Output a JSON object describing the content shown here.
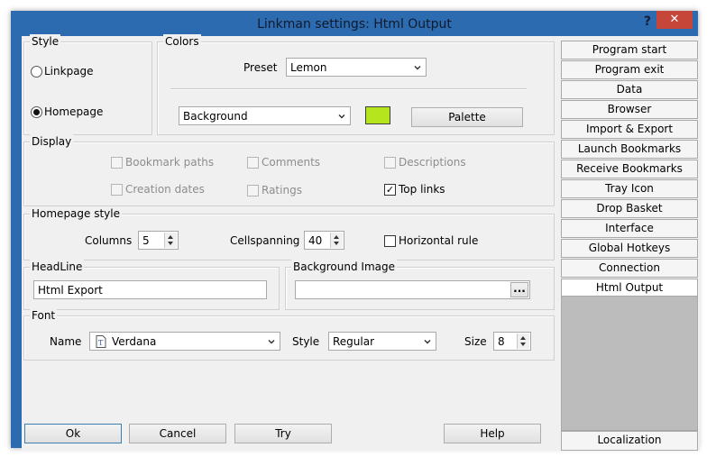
{
  "window": {
    "title": "Linkman settings: Html Output",
    "help_glyph": "?",
    "close_glyph": "✕"
  },
  "style_group": {
    "label": "Style",
    "linkpage": "Linkpage",
    "homepage": "Homepage",
    "selected": "Homepage"
  },
  "colors_group": {
    "label": "Colors",
    "preset_label": "Preset",
    "preset_value": "Lemon",
    "target_value": "Background",
    "swatch_color": "#b5e61d",
    "palette_button": "Palette"
  },
  "display_group": {
    "label": "Display",
    "items": [
      {
        "label": "Bookmark paths",
        "checked": false,
        "enabled": false
      },
      {
        "label": "Comments",
        "checked": false,
        "enabled": false
      },
      {
        "label": "Descriptions",
        "checked": false,
        "enabled": false
      },
      {
        "label": "Creation dates",
        "checked": false,
        "enabled": false
      },
      {
        "label": "Ratings",
        "checked": false,
        "enabled": false
      },
      {
        "label": "Top links",
        "checked": true,
        "enabled": true
      }
    ]
  },
  "homepage_style": {
    "label": "Homepage style",
    "columns_label": "Columns",
    "columns_value": "5",
    "cellspanning_label": "Cellspanning",
    "cellspanning_value": "40",
    "horizontal_rule_label": "Horizontal rule",
    "horizontal_rule_checked": false
  },
  "headline": {
    "label": "HeadLine",
    "value": "Html Export"
  },
  "background_image": {
    "label": "Background Image",
    "value": "",
    "browse_button": "..."
  },
  "font": {
    "label": "Font",
    "name_label": "Name",
    "name_value": "Verdana",
    "style_label": "Style",
    "style_value": "Regular",
    "size_label": "Size",
    "size_value": "8"
  },
  "buttons": {
    "ok": "Ok",
    "cancel": "Cancel",
    "try": "Try",
    "help": "Help"
  },
  "sidebar": {
    "items": [
      "Program start",
      "Program exit",
      "Data",
      "Browser",
      "Import & Export",
      "Launch Bookmarks",
      "Receive Bookmarks",
      "Tray Icon",
      "Drop Basket",
      "Interface",
      "Global Hotkeys",
      "Connection",
      "Html Output"
    ],
    "active": "Html Output",
    "bottom_item": "Localization"
  }
}
